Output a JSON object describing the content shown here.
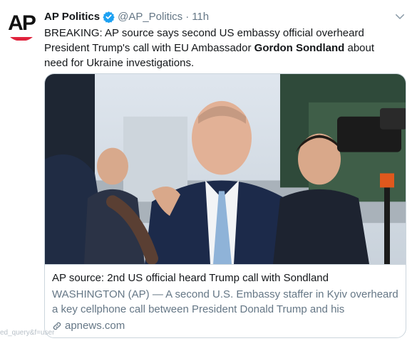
{
  "tweet": {
    "author": {
      "avatar_logo": "AP",
      "display_name": "AP Politics",
      "handle": "@AP_Politics",
      "verified": true
    },
    "separator": "·",
    "timestamp": "11h",
    "text_before": "BREAKING: AP source says second US embassy official overheard President Trump's call with EU Ambassador ",
    "text_bold": "Gordon Sondland",
    "text_after": " about need for Ukraine investigations."
  },
  "card": {
    "image_alt": "news photo",
    "title": "AP source: 2nd US official heard Trump call with Sondland",
    "description": "WASHINGTON (AP) — A second U.S. Embassy staffer in Kyiv overheard a key cellphone call between President Donald Trump and his ambassado...",
    "domain": "apnews.com"
  },
  "url_fragment": "ed_query&f=user",
  "colors": {
    "brand_red": "#e0233d",
    "verified_blue": "#1da1f2",
    "muted": "#657786",
    "border": "#ccd6dd"
  },
  "icons": [
    "verified-badge-icon",
    "chevron-down-icon",
    "link-icon"
  ]
}
